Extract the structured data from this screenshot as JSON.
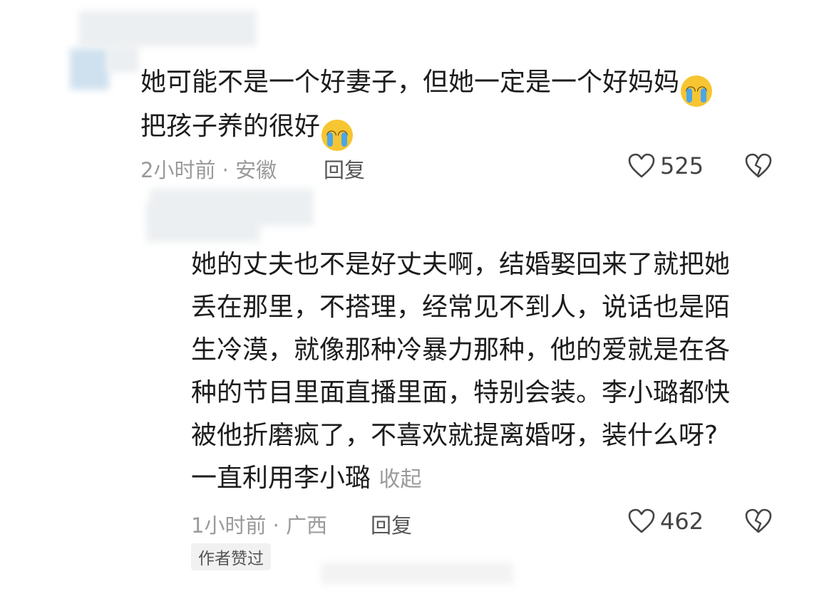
{
  "comment1": {
    "lines": [
      "她可能不是一个好妻子，但她一定是一个好妈妈",
      "把孩子养的很好"
    ],
    "emoji": "crying-face",
    "time_location": "2小时前 · 安徽",
    "reply_label": "回复",
    "like_count": "525"
  },
  "comment2": {
    "lines": [
      "她的丈夫也不是好丈夫啊，结婚娶回来了就把她",
      "丢在那里，不搭理，经常见不到人，说话也是陌",
      "生冷漠，就像那种冷暴力那种，他的爱就是在各",
      "种的节目里面直播里面，特别会装。李小璐都快",
      "被他折磨疯了，不喜欢就提离婚呀，装什么呀?",
      "一直利用李小璐"
    ],
    "collapse_label": "收起",
    "time_location": "1小时前 · 广西",
    "reply_label": "回复",
    "like_count": "462",
    "author_badge": "作者赞过"
  },
  "colors": {
    "meta_gray": "#9a9a9a",
    "text": "#1c1c1c",
    "avatar_blur": "#cfe1ee"
  }
}
